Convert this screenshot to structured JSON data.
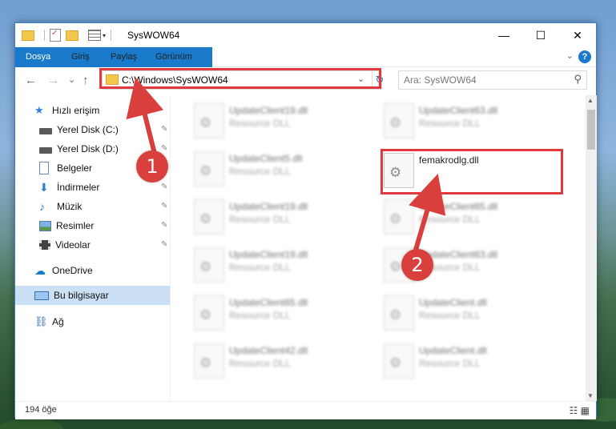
{
  "window": {
    "title": "SysWOW64",
    "controls": {
      "minimize": "—",
      "maximize": "☐",
      "close": "✕"
    }
  },
  "ribbon": {
    "tabs": [
      "Dosya",
      "Giriş",
      "Paylaş",
      "Görünüm"
    ],
    "help_icon": "?"
  },
  "nav": {
    "back_icon": "←",
    "forward_icon": "→",
    "recent_icon": "⌄",
    "up_icon": "↑",
    "address": "C:\\Windows\\SysWOW64",
    "search_placeholder": "Ara: SysWOW64"
  },
  "sidebar": {
    "items": [
      {
        "label": "Hızlı erişim",
        "icon": "star-icon"
      },
      {
        "label": "Yerel Disk (C:)",
        "icon": "drive-icon",
        "pinned": true
      },
      {
        "label": "Yerel Disk (D:)",
        "icon": "drive-icon",
        "pinned": true
      },
      {
        "label": "Belgeler",
        "icon": "document-icon",
        "pinned": true
      },
      {
        "label": "İndirmeler",
        "icon": "download-icon",
        "pinned": true
      },
      {
        "label": "Müzik",
        "icon": "music-icon",
        "pinned": true
      },
      {
        "label": "Resimler",
        "icon": "pictures-icon",
        "pinned": true
      },
      {
        "label": "Videolar",
        "icon": "video-icon",
        "pinned": true
      },
      {
        "label": "OneDrive",
        "icon": "cloud-icon"
      },
      {
        "label": "Bu bilgisayar",
        "icon": "computer-icon",
        "selected": true
      },
      {
        "label": "Ağ",
        "icon": "network-icon"
      }
    ],
    "pin_icon": "📌"
  },
  "files": {
    "left": [
      {
        "name": "UpdateClient19.dll",
        "type": "Resource DLL"
      },
      {
        "name": "UpdateClient5.dll",
        "type": "Resource DLL"
      },
      {
        "name": "UpdateClient19.dll",
        "type": "Resource DLL"
      },
      {
        "name": "UpdateClient19.dll",
        "type": "Resource DLL"
      },
      {
        "name": "UpdateClient65.dll",
        "type": "Resource DLL"
      },
      {
        "name": "UpdateClient42.dll",
        "type": "Resource DLL"
      }
    ],
    "right": [
      {
        "name": "UpdateClient63.dll",
        "type": "Resource DLL"
      },
      {
        "name": "femakrodlg.dll",
        "type": "",
        "highlighted": true
      },
      {
        "name": "UpdateClient65.dll",
        "type": "Resource DLL"
      },
      {
        "name": "UpdateClient63.dll",
        "type": "Resource DLL"
      },
      {
        "name": "UpdateClient.dll",
        "type": "Resource DLL"
      },
      {
        "name": "UpdateClient.dll",
        "type": "Resource DLL"
      }
    ]
  },
  "status": {
    "item_count": "194 öğe"
  },
  "callouts": {
    "one": "1",
    "two": "2"
  },
  "colors": {
    "accent": "#1979ca",
    "highlight": "#e0393e",
    "selected_bg": "#cce0f5"
  }
}
